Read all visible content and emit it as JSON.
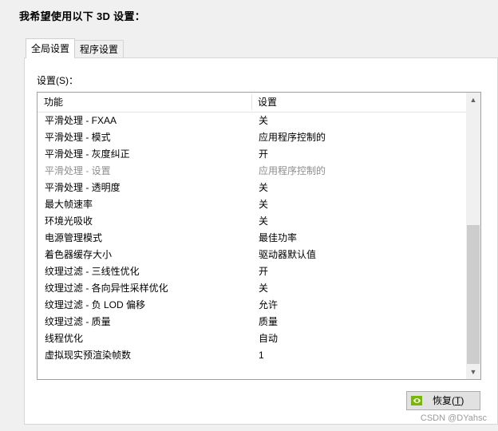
{
  "heading": "我希望使用以下 3D 设置：",
  "tabs": [
    {
      "label": "全局设置",
      "active": true
    },
    {
      "label": "程序设置",
      "active": false
    }
  ],
  "settings_label": "设置(S)：",
  "columns": {
    "feature": "功能",
    "setting": "设置"
  },
  "rows": [
    {
      "feature": "平滑处理 - FXAA",
      "value": "关",
      "enabled": true
    },
    {
      "feature": "平滑处理 - 模式",
      "value": "应用程序控制的",
      "enabled": true
    },
    {
      "feature": "平滑处理 - 灰度纠正",
      "value": "开",
      "enabled": true
    },
    {
      "feature": "平滑处理 - 设置",
      "value": "应用程序控制的",
      "enabled": false
    },
    {
      "feature": "平滑处理 - 透明度",
      "value": "关",
      "enabled": true
    },
    {
      "feature": "最大帧速率",
      "value": "关",
      "enabled": true
    },
    {
      "feature": "环境光吸收",
      "value": "关",
      "enabled": true
    },
    {
      "feature": "电源管理模式",
      "value": "最佳功率",
      "enabled": true
    },
    {
      "feature": "着色器缓存大小",
      "value": "驱动器默认值",
      "enabled": true
    },
    {
      "feature": "纹理过滤 - 三线性优化",
      "value": "开",
      "enabled": true
    },
    {
      "feature": "纹理过滤 - 各向异性采样优化",
      "value": "关",
      "enabled": true
    },
    {
      "feature": "纹理过滤 - 负 LOD 偏移",
      "value": "允许",
      "enabled": true
    },
    {
      "feature": "纹理过滤 - 质量",
      "value": "质量",
      "enabled": true
    },
    {
      "feature": "线程优化",
      "value": "自动",
      "enabled": true
    },
    {
      "feature": "虚拟现实预渲染帧数",
      "value": "1",
      "enabled": true
    }
  ],
  "restore_button": {
    "label": "恢复(",
    "hotkey": "T",
    "suffix": ")",
    "icon": "nvidia-logo-icon"
  },
  "watermark": "CSDN @DYahsc",
  "colors": {
    "disabled_text": "#8d8d8d",
    "nvidia_green": "#76b900"
  }
}
